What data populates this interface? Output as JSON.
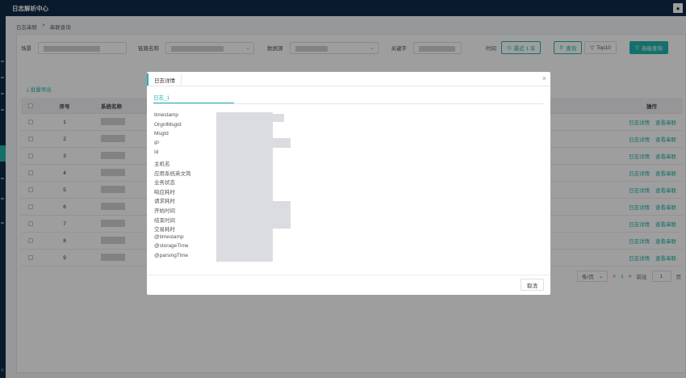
{
  "app": {
    "title": "日志解析中心"
  },
  "breadcrumb": [
    "日志串联",
    "串联查询"
  ],
  "filters": {
    "scene_label": "场景",
    "link_label": "链路名称",
    "datasource_label": "数据源",
    "keyword_label": "关键字",
    "time_label": "时间",
    "time_value": "最近 1 年",
    "query_button": "查询",
    "top10_button": "Top10",
    "advanced_button": "高级查询"
  },
  "export_link": "批量导出",
  "table": {
    "headers": {
      "no": "序号",
      "system": "系统名称",
      "ops": "操作"
    },
    "rows": [
      1,
      2,
      3,
      4,
      5,
      6,
      7,
      8,
      9
    ],
    "action_detail": "日志详情",
    "action_link": "查看串联"
  },
  "pager": {
    "per_page": "条/页",
    "current": "1",
    "goto_label": "前往",
    "goto_value": "1",
    "page_unit": "页"
  },
  "modal": {
    "title": "日志详情",
    "tab": "日志_1",
    "fields": [
      "timestamp",
      "OrgnlMsgId",
      "MsgId",
      "IP",
      "Id",
      "主机名",
      "应用系统英文简",
      "业务状态",
      "响应耗时",
      "请求耗时",
      "开始时间",
      "结束时间",
      "交易耗时",
      "@timestamp",
      "@storageTime",
      "@parsingTime"
    ],
    "cancel": "取消"
  },
  "colors": {
    "accent": "#1fb5ad",
    "topbar": "#0f2a48"
  },
  "icons": {
    "user": "user-icon",
    "close": "close-icon",
    "search": "search-icon",
    "filter": "filter-icon",
    "clock": "clock-icon"
  }
}
